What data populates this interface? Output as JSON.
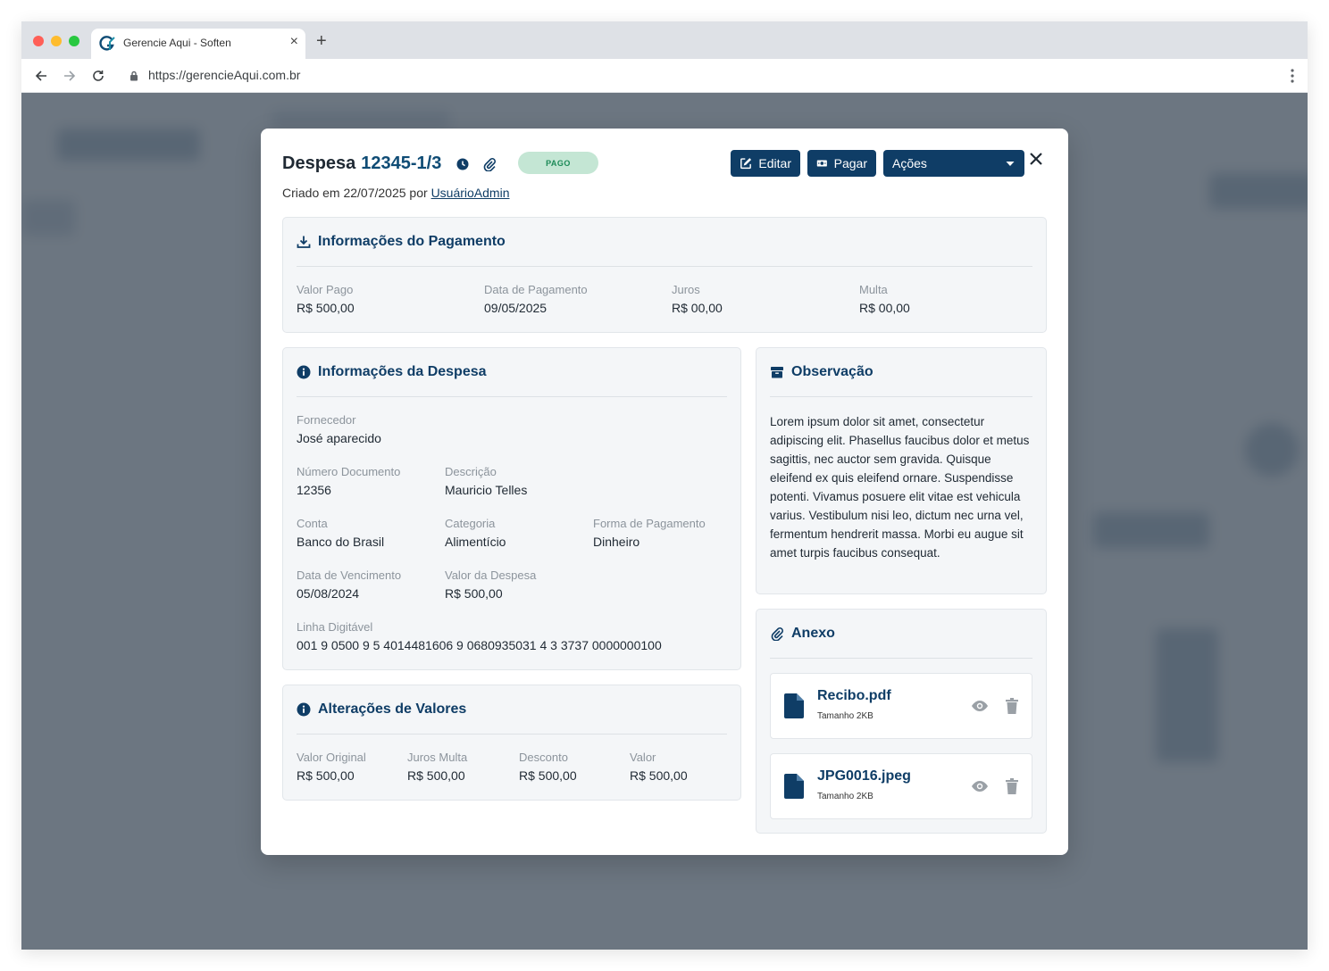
{
  "browser": {
    "tab_title": "Gerencie Aqui - Soften",
    "url": "https://gerencieAqui.com.br"
  },
  "modal": {
    "title_prefix": "Despesa",
    "title_number": "12345-1/3",
    "status": "PAGO",
    "created_text": "Criado em 22/07/2025 por",
    "created_by": "UsuárioAdmin",
    "buttons": {
      "edit": "Editar",
      "pay": "Pagar",
      "actions": "Ações"
    }
  },
  "payment_info": {
    "title": "Informações do Pagamento",
    "fields": [
      {
        "label": "Valor Pago",
        "value": "R$ 500,00"
      },
      {
        "label": "Data de Pagamento",
        "value": "09/05/2025"
      },
      {
        "label": "Juros",
        "value": "R$ 00,00"
      },
      {
        "label": "Multa",
        "value": "R$ 00,00"
      }
    ]
  },
  "expense_info": {
    "title": "Informações da Despesa",
    "fornecedor": {
      "label": "Fornecedor",
      "value": "José aparecido"
    },
    "numero_documento": {
      "label": "Número Documento",
      "value": "12356"
    },
    "descricao": {
      "label": "Descrição",
      "value": "Mauricio Telles"
    },
    "conta": {
      "label": "Conta",
      "value": "Banco do Brasil"
    },
    "categoria": {
      "label": "Categoria",
      "value": "Alimentício"
    },
    "forma_pagamento": {
      "label": "Forma de Pagamento",
      "value": "Dinheiro"
    },
    "data_vencimento": {
      "label": "Data de Vencimento",
      "value": "05/08/2024"
    },
    "valor_despesa": {
      "label": "Valor da Despesa",
      "value": "R$ 500,00"
    },
    "linha_digitavel": {
      "label": "Linha Digitável",
      "value": "001 9 0500 9 5 4014481606 9 0680935031 4 3 3737 0000000100"
    }
  },
  "value_changes": {
    "title": "Alterações de Valores",
    "fields": [
      {
        "label": "Valor Original",
        "value": "R$ 500,00"
      },
      {
        "label": "Juros Multa",
        "value": "R$ 500,00"
      },
      {
        "label": "Desconto",
        "value": "R$ 500,00"
      },
      {
        "label": "Valor",
        "value": "R$ 500,00"
      }
    ]
  },
  "observation": {
    "title": "Observação",
    "text": "Lorem ipsum dolor sit amet, consectetur adipiscing elit. Phasellus faucibus dolor et metus sagittis, nec auctor sem gravida. Quisque eleifend ex quis eleifend ornare. Suspendisse potenti. Vivamus posuere elit vitae est vehicula varius. Vestibulum nisi leo, dictum nec urna vel, fermentum hendrerit massa. Morbi eu augue sit amet turpis faucibus consequat."
  },
  "attachments": {
    "title": "Anexo",
    "files": [
      {
        "name": "Recibo.pdf",
        "size": "Tamanho 2KB"
      },
      {
        "name": "JPG0016.jpeg",
        "size": "Tamanho 2KB"
      }
    ]
  },
  "colors": {
    "primary": "#0f3d66",
    "badge_bg": "#c4e6d4",
    "badge_text": "#1c8a57",
    "card_bg": "#f4f6f8"
  }
}
